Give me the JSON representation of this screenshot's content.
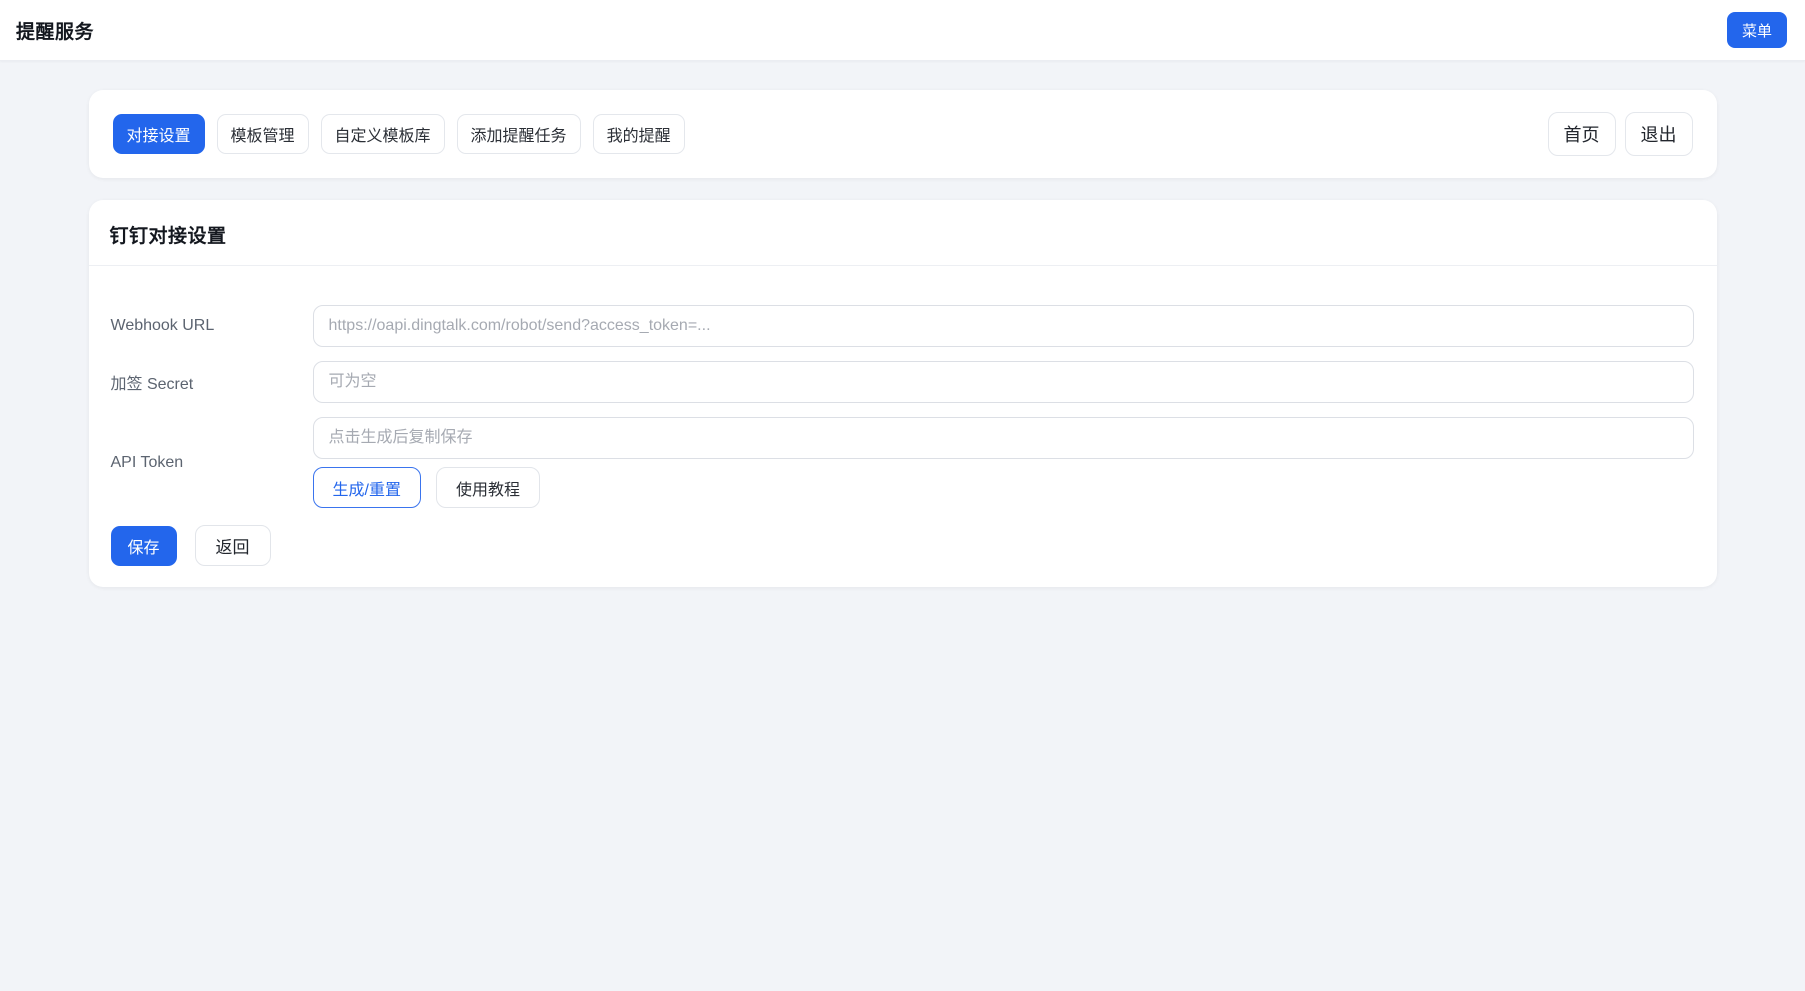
{
  "header": {
    "title": "提醒服务",
    "menu_button_label": "菜单"
  },
  "nav": {
    "tabs": [
      {
        "label": "对接设置",
        "active": true
      },
      {
        "label": "模板管理",
        "active": false
      },
      {
        "label": "自定义模板库",
        "active": false
      },
      {
        "label": "添加提醒任务",
        "active": false
      },
      {
        "label": "我的提醒",
        "active": false
      }
    ],
    "home_button_label": "首页",
    "logout_button_label": "退出"
  },
  "settings_card": {
    "title": "钉钉对接设置",
    "fields": [
      {
        "label": "Webhook URL",
        "value": "",
        "placeholder": "https://oapi.dingtalk.com/robot/send?access_token=..."
      },
      {
        "label": "加签 Secret",
        "value": "",
        "placeholder": "可为空"
      },
      {
        "label": "API Token",
        "value": "",
        "placeholder": "点击生成后复制保存"
      }
    ],
    "generate_button_label": "生成/重置",
    "tutorial_button_label": "使用教程",
    "save_button_label": "保存",
    "back_button_label": "返回"
  },
  "colors": {
    "accent_blue": "#2366ec",
    "page_background": "#f2f4f8",
    "card_background": "#ffffff",
    "input_border": "#dcdfe5",
    "placeholder_text": "#a6aab2"
  }
}
